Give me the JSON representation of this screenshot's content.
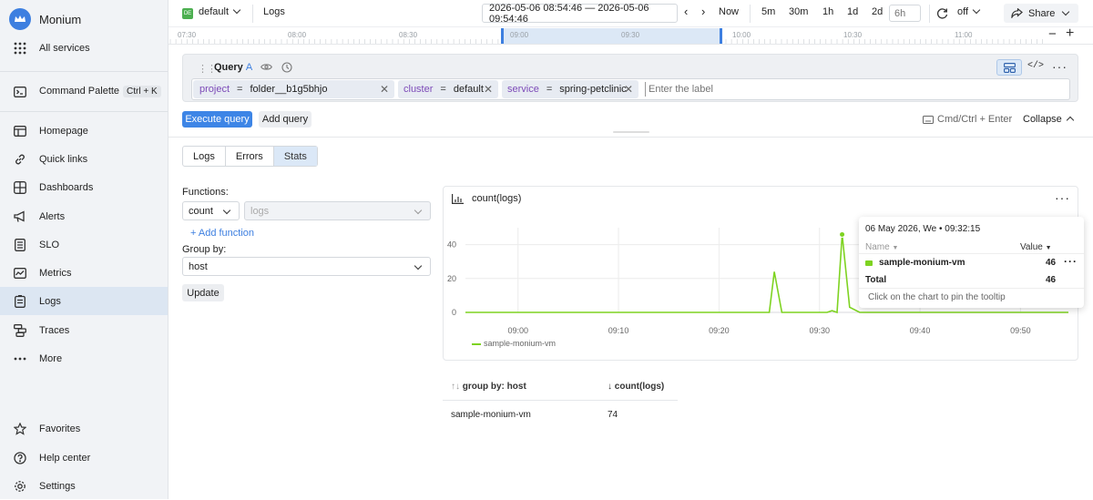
{
  "sidebar": {
    "brand": "Monium",
    "all_services": "All services",
    "command_palette": "Command Palette",
    "shortcut": "Ctrl + K",
    "items": [
      {
        "label": "Homepage"
      },
      {
        "label": "Quick links"
      },
      {
        "label": "Dashboards"
      },
      {
        "label": "Alerts"
      },
      {
        "label": "SLO"
      },
      {
        "label": "Metrics"
      },
      {
        "label": "Logs"
      },
      {
        "label": "Traces"
      },
      {
        "label": "More"
      }
    ],
    "bottom": [
      {
        "label": "Favorites"
      },
      {
        "label": "Help center"
      },
      {
        "label": "Settings"
      }
    ]
  },
  "topbar": {
    "project_badge": "DE",
    "project": "default",
    "page": "Logs",
    "time_range": "2026-05-06 08:54:46 — 2026-05-06 09:54:46",
    "now": "Now",
    "presets": [
      "5m",
      "30m",
      "1h",
      "1d",
      "2d"
    ],
    "custom_placeholder": "6h",
    "refresh": "off",
    "share": "Share"
  },
  "timeline": {
    "ticks": [
      "07:30",
      "08:00",
      "08:30",
      "09:00",
      "09:30",
      "10:00",
      "10:30",
      "11:00"
    ],
    "selection_start": "08:54:46",
    "selection_end": "09:54:46"
  },
  "query": {
    "title": "Query",
    "letter": "A",
    "chips": [
      {
        "key": "project",
        "op": "=",
        "value": "folder__b1g5bhjo"
      },
      {
        "key": "cluster",
        "op": "=",
        "value": "default"
      },
      {
        "key": "service",
        "op": "=",
        "value": "spring-petclinic"
      }
    ],
    "label_placeholder": "Enter the label",
    "execute": "Execute query",
    "add": "Add query",
    "shortcut_hint": "Cmd/Ctrl + Enter",
    "collapse": "Collapse"
  },
  "tabs": {
    "items": [
      "Logs",
      "Errors",
      "Stats"
    ],
    "active": "Stats"
  },
  "stats": {
    "functions_label": "Functions:",
    "function": "count",
    "field_placeholder": "logs",
    "add_function": "+ Add function",
    "group_by_label": "Group by:",
    "group_by": "host",
    "update": "Update"
  },
  "chart": {
    "title": "count(logs)",
    "legend": "sample-monium-vm",
    "tooltip": {
      "header": "06 May 2026, We • 09:32:15",
      "name_col": "Name",
      "value_col": "Value",
      "series": "sample-monium-vm",
      "value": "46",
      "total_label": "Total",
      "total": "46",
      "hint": "Click on the chart to pin the tooltip"
    }
  },
  "chart_data": {
    "type": "line",
    "title": "count(logs)",
    "xlabel": "",
    "ylabel": "",
    "x_ticks": [
      "09:00",
      "09:10",
      "09:20",
      "09:30",
      "09:40",
      "09:50"
    ],
    "y_ticks": [
      0,
      20,
      40
    ],
    "ylim": [
      0,
      50
    ],
    "xlim": [
      "08:54:46",
      "09:54:46"
    ],
    "series": [
      {
        "name": "sample-monium-vm",
        "color": "#7ed321",
        "points": [
          [
            "08:54:46",
            0
          ],
          [
            "09:25:00",
            0
          ],
          [
            "09:25:30",
            24
          ],
          [
            "09:26:15",
            0
          ],
          [
            "09:30:45",
            0
          ],
          [
            "09:31:15",
            1
          ],
          [
            "09:31:45",
            0
          ],
          [
            "09:32:15",
            46
          ],
          [
            "09:33:00",
            3
          ],
          [
            "09:34:00",
            0
          ],
          [
            "09:54:46",
            0
          ]
        ]
      }
    ],
    "legend": "bottom-left",
    "grid": true
  },
  "table": {
    "headers": [
      "group by: host",
      "count(logs)"
    ],
    "rows": [
      [
        "sample-monium-vm",
        "74"
      ]
    ]
  }
}
